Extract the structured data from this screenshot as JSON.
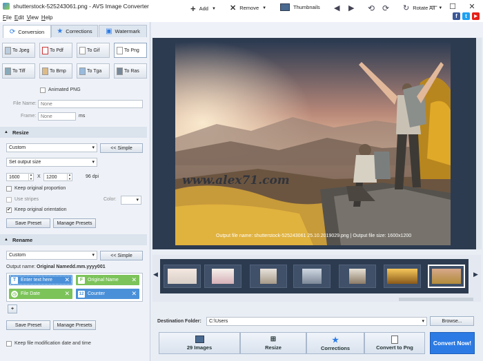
{
  "window": {
    "title": "shutterstock-525243061.png - AVS Image Converter",
    "minimize": "—",
    "maximize": "☐",
    "close": "✕"
  },
  "menu": [
    "File",
    "Edit",
    "View",
    "Help"
  ],
  "social": {
    "facebook": "f",
    "twitter": "t",
    "youtube": "▶"
  },
  "toolbar": {
    "add": "Add",
    "remove": "Remove",
    "thumbnails": "Thumbnails",
    "rotate_all": "Rotate All"
  },
  "tabs": {
    "conversion": "Conversion",
    "corrections": "Corrections",
    "watermark": "Watermark"
  },
  "formats": [
    "To Jpeg",
    "To Pdf",
    "To Gif",
    "To Png",
    "To Tiff",
    "To Bmp",
    "To Tga",
    "To Ras"
  ],
  "animated_png": "Animated PNG",
  "file_name": {
    "label": "File Name:",
    "placeholder": "None"
  },
  "frame": {
    "label": "Frame:",
    "value": "None",
    "unit": "ms"
  },
  "resize": {
    "title": "Resize",
    "mode": "Custom",
    "simple": "<< Simple",
    "size_mode": "Set output size",
    "width": "1600",
    "x": "X",
    "height": "1200",
    "dpi": "96 dpi",
    "keep_proportion": "Keep original proportion",
    "use_stripes": "Use stripes",
    "color": "Color:",
    "keep_orientation": "Keep original orientation",
    "save_preset": "Save Preset",
    "manage_presets": "Manage Presets"
  },
  "rename": {
    "title": "Rename",
    "mode": "Custom",
    "simple": "<< Simple",
    "output_label": "Output name:",
    "output_value": "Original Namedd.mm.yyyy001",
    "tags": [
      "Enter text here",
      "Original Name",
      "File Date",
      "Counter"
    ],
    "add": "+",
    "save_preset": "Save Preset",
    "manage_presets": "Manage Presets"
  },
  "keep_modification": "Keep file modification date and time",
  "preview": {
    "watermark": "www.alex71.com",
    "caption": "Output file name: shutterstock-525243061 25.10.2019029.png | Output file size: 1600x1200"
  },
  "destination": {
    "label": "Destination Folder:",
    "value": "C:\\Users",
    "browse": "Browse..."
  },
  "steps": [
    "29 Images",
    "Resize",
    "Corrections",
    "Convert to Png"
  ],
  "convert_now": "Convert Now!",
  "colors": {
    "accent": "#2c7be5",
    "tag_blue": "#4a90d9",
    "tag_green": "#7cc35a",
    "panel": "#2d3b50"
  }
}
